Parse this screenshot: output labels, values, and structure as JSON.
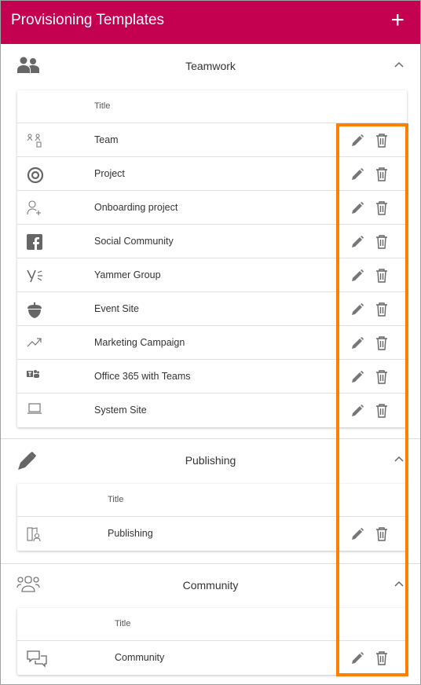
{
  "header": {
    "title": "Provisioning Templates",
    "add_icon": "plus-icon"
  },
  "sections": [
    {
      "label": "Teamwork",
      "icon": "people-icon",
      "column_title": "Title",
      "rows": [
        {
          "title": "Team",
          "icon": "team-icon"
        },
        {
          "title": "Project",
          "icon": "target-icon"
        },
        {
          "title": "Onboarding project",
          "icon": "add-person-icon"
        },
        {
          "title": "Social Community",
          "icon": "facebook-icon"
        },
        {
          "title": "Yammer Group",
          "icon": "yammer-icon"
        },
        {
          "title": "Event Site",
          "icon": "acorn-icon"
        },
        {
          "title": "Marketing Campaign",
          "icon": "trending-icon"
        },
        {
          "title": "Office 365 with Teams",
          "icon": "teams-icon"
        },
        {
          "title": "System Site",
          "icon": "laptop-icon"
        }
      ]
    },
    {
      "label": "Publishing",
      "icon": "pen-icon",
      "column_title": "Title",
      "rows": [
        {
          "title": "Publishing",
          "icon": "publishing-icon"
        }
      ]
    },
    {
      "label": "Community",
      "icon": "community-icon",
      "column_title": "Title",
      "rows": [
        {
          "title": "Community",
          "icon": "chat-icon"
        }
      ]
    }
  ],
  "colors": {
    "header": "#c40050",
    "highlight": "#ff8000"
  }
}
